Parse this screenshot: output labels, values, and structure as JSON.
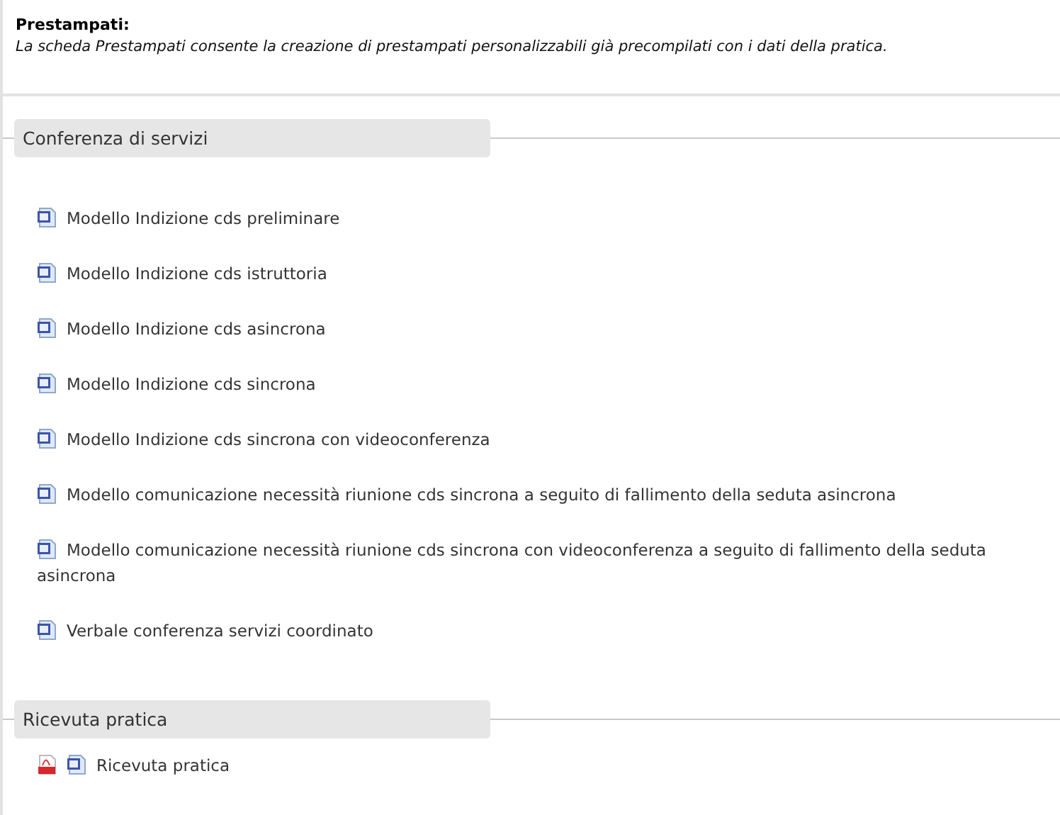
{
  "header": {
    "title": "Prestampati:",
    "description": "La scheda Prestampati consente la creazione di prestampati personalizzabili già precompilati con i dati della pratica."
  },
  "sections": [
    {
      "title": "Conferenza di servizi",
      "items": [
        {
          "label": "Modello Indizione cds preliminare",
          "icons": [
            {
              "kind": "word"
            }
          ]
        },
        {
          "label": "Modello Indizione cds istruttoria",
          "icons": [
            {
              "kind": "word"
            }
          ]
        },
        {
          "label": "Modello Indizione cds asincrona",
          "icons": [
            {
              "kind": "word"
            }
          ]
        },
        {
          "label": "Modello Indizione cds sincrona",
          "icons": [
            {
              "kind": "word"
            }
          ]
        },
        {
          "label": "Modello Indizione cds sincrona con videoconferenza",
          "icons": [
            {
              "kind": "word"
            }
          ]
        },
        {
          "label": "Modello comunicazione necessità riunione cds sincrona a seguito di fallimento della seduta asincrona",
          "icons": [
            {
              "kind": "word"
            }
          ]
        },
        {
          "label": "Modello comunicazione necessità riunione cds sincrona con videoconferenza a seguito di fallimento della seduta asincrona",
          "icons": [
            {
              "kind": "word"
            }
          ]
        },
        {
          "label": "Verbale conferenza servizi coordinato",
          "icons": [
            {
              "kind": "word"
            }
          ]
        }
      ]
    },
    {
      "title": "Ricevuta pratica",
      "items": [
        {
          "label": "Ricevuta pratica",
          "icons": [
            {
              "kind": "pdf"
            },
            {
              "kind": "word"
            }
          ]
        }
      ]
    }
  ]
}
